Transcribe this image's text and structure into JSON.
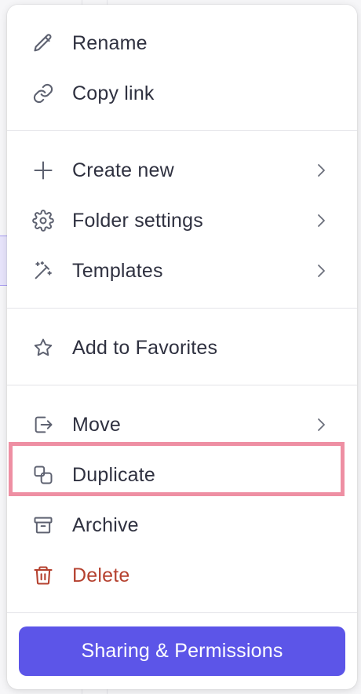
{
  "menu": {
    "items": [
      {
        "label": "Rename",
        "icon": "pencil-icon"
      },
      {
        "label": "Copy link",
        "icon": "link-icon"
      },
      {
        "label": "Create new",
        "icon": "plus-icon",
        "submenu": true
      },
      {
        "label": "Folder settings",
        "icon": "gear-icon",
        "submenu": true
      },
      {
        "label": "Templates",
        "icon": "magic-wand-icon",
        "submenu": true
      },
      {
        "label": "Add to Favorites",
        "icon": "star-icon"
      },
      {
        "label": "Move",
        "icon": "move-out-icon",
        "submenu": true
      },
      {
        "label": "Duplicate",
        "icon": "duplicate-icon",
        "highlighted": true
      },
      {
        "label": "Archive",
        "icon": "archive-box-icon"
      },
      {
        "label": "Delete",
        "icon": "trash-icon",
        "danger": true
      }
    ],
    "primary_button": "Sharing & Permissions"
  },
  "colors": {
    "text": "#2f3140",
    "icon": "#5d6170",
    "danger": "#b5412f",
    "accent": "#5c55e8",
    "highlight_outline": "#ee8fa3"
  }
}
